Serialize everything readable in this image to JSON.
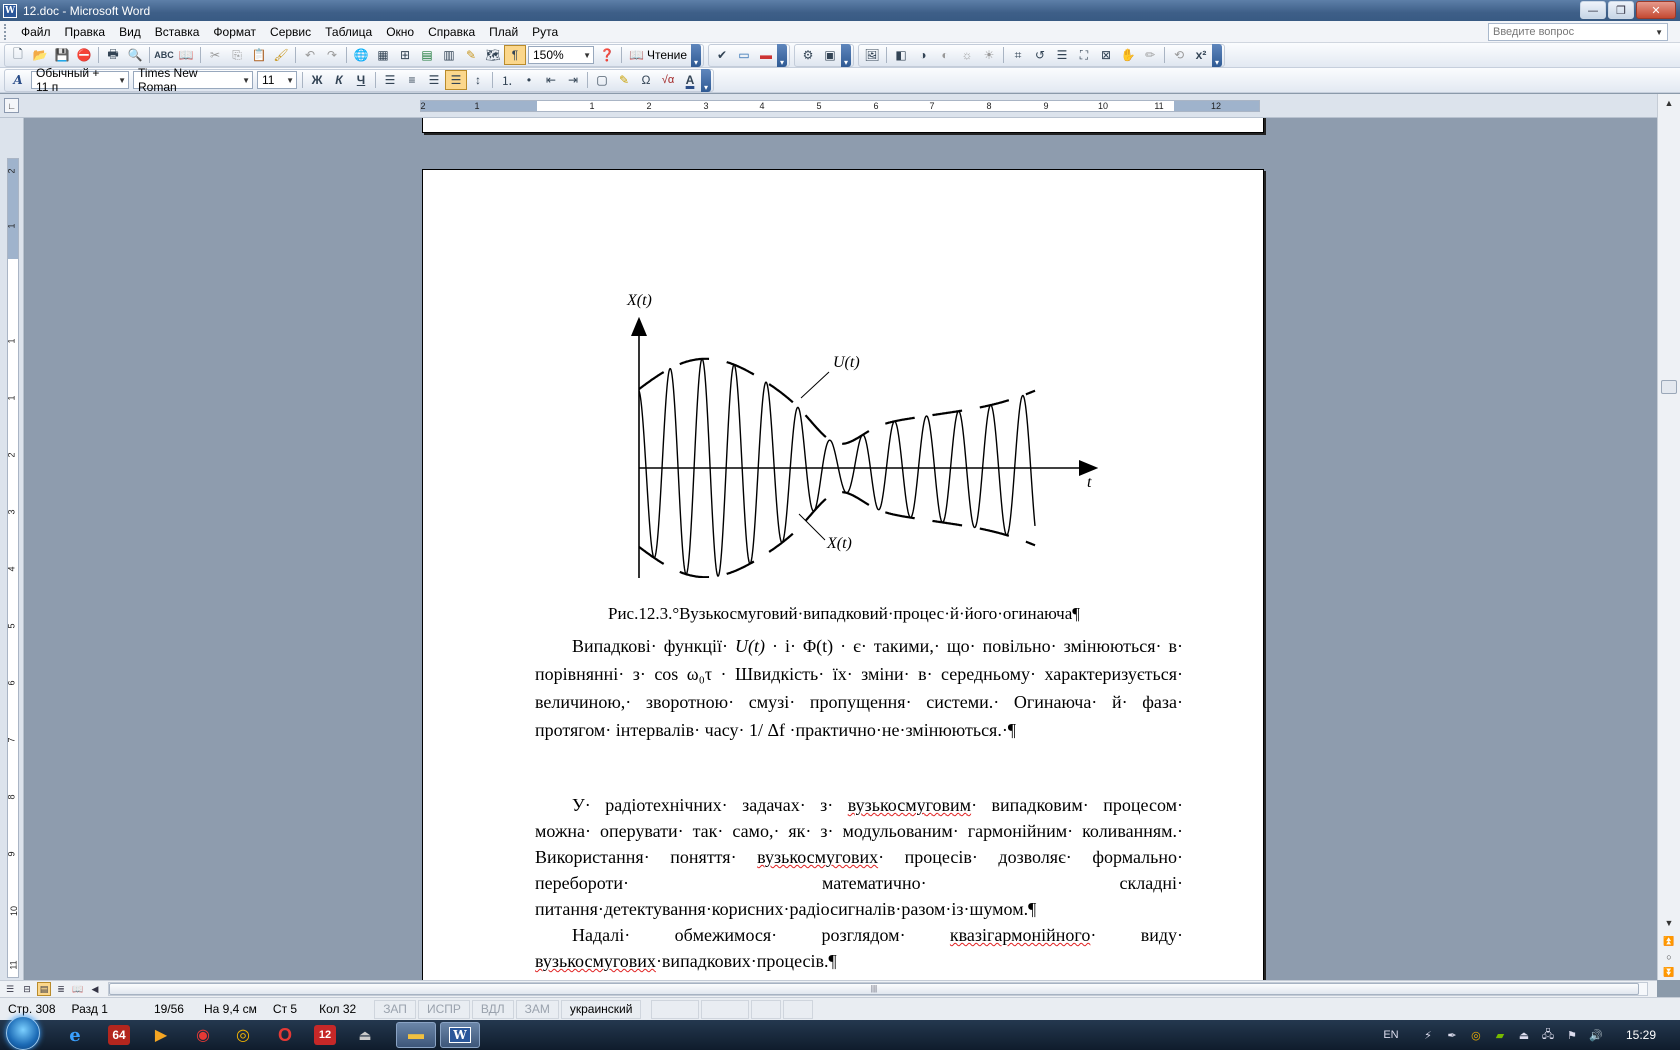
{
  "window": {
    "title": "12.doc - Microsoft Word",
    "app_icon": "W"
  },
  "window_buttons": {
    "minimize": "—",
    "restore": "❐",
    "close": "✕"
  },
  "menu": {
    "items": [
      {
        "label": "Файл"
      },
      {
        "label": "Правка"
      },
      {
        "label": "Вид"
      },
      {
        "label": "Вставка"
      },
      {
        "label": "Формат"
      },
      {
        "label": "Сервис"
      },
      {
        "label": "Таблица"
      },
      {
        "label": "Окно"
      },
      {
        "label": "Справка"
      },
      {
        "label": "Плай"
      },
      {
        "label": "Рута"
      }
    ],
    "help_placeholder": "Введите вопрос"
  },
  "toolbar_standard": {
    "zoom": "150%",
    "reading_label": "Чтение",
    "pilcrow": "¶"
  },
  "toolbar_format": {
    "style": "Обычный + 11 п",
    "font": "Times New Roman",
    "size": "11",
    "bold": "Ж",
    "italic": "К",
    "underline": "Ч",
    "omega": "Ω",
    "sqrt": "√α",
    "font_color_glyph": "A"
  },
  "ruler": {
    "horizontal_numbers": [
      "2",
      "1",
      "1",
      "2",
      "3",
      "4",
      "5",
      "6",
      "7",
      "8",
      "9",
      "10",
      "11",
      "12"
    ],
    "vertical_numbers": [
      "2",
      "1",
      "1",
      "1",
      "2",
      "3",
      "4",
      "5",
      "6",
      "7",
      "8",
      "9",
      "10",
      "11",
      "12"
    ]
  },
  "document": {
    "figure": {
      "y_axis_label": "X(t)",
      "x_axis_label": "t",
      "envelope_label": "U(t)",
      "signal_label": "X(t)"
    },
    "caption": "Рис.12.3.°Вузькосмуговий·випадковий·процес·й·його·огинаюча¶",
    "paragraphs": [
      {
        "p1a": "Випадкові· функції· ",
        "u": "U(t)",
        "p1b": " · і· ",
        "phi": "Φ(t)",
        "p1c": " · є· такими,· що· повільно· змінюються· в· порівнянні· з· ",
        "cos": "cos ω₀τ",
        "p1d": " · Швидкість· їх· зміни· в· середньому· характеризується· величиною,· зворотною· смузі· пропущення· системи.· Огинаюча· й· фаза· протягом· інтервалів· часу· ",
        "df": "1/ Δf",
        "p1e": "  ·практично·не·змінюються.·¶"
      },
      {
        "p2a": "У· радіотехнічних· задачах· з· ",
        "p2w1": "вузькосмуговим",
        "p2b": "· випадковим· процесом· можна· оперувати· так· само,· як· з· модульованим· гармонійним· коливанням.· Використання· поняття· ",
        "p2w2": "вузькосмугових",
        "p2c": "· процесів· дозволяє· формально· перебороти· математично· складні· питання·детектування·корисних·радіосигналів·разом·із·шумом.¶"
      },
      {
        "p3a": "Надалі· обмежимося· розглядом· ",
        "p3w1": "квазігармонійного",
        "p3b": "· виду· ",
        "p3w2": "вузькосмугових",
        "p3c": "·випадкових·процесів.¶"
      }
    ]
  },
  "statusbar": {
    "page": "Стр. 308",
    "section": "Разд 1",
    "pages": "19/56",
    "at": "На 9,4 см",
    "line": "Ст 5",
    "col": "Кол 32",
    "rec": "ЗАП",
    "trk": "ИСПР",
    "ext": "ВДЛ",
    "ovr": "ЗАМ",
    "language": "украинский"
  },
  "taskbar": {
    "pinned": [
      "ie",
      "64",
      "media",
      "pacman",
      "chrome",
      "opera",
      "12",
      "usb",
      "folder",
      "word"
    ],
    "icon_64": "64",
    "icon_12": "12",
    "tray_lang": "EN",
    "clock": "15:29"
  }
}
